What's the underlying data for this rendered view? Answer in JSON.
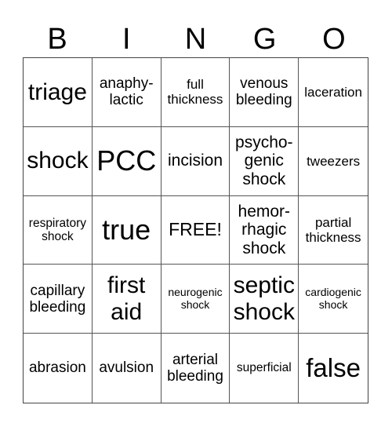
{
  "header": {
    "letters": [
      "B",
      "I",
      "N",
      "G",
      "O"
    ]
  },
  "card": {
    "cells": [
      "triage",
      "anaphy-\nlactic",
      "full\nthickness",
      "venous\nbleeding",
      "laceration",
      "shock",
      "PCC",
      "incision",
      "psycho-\ngenic\nshock",
      "tweezers",
      "respiratory\nshock",
      "true",
      "FREE!",
      "hemor-\nrhagic\nshock",
      "partial\nthickness",
      "capillary\nbleeding",
      "first\naid",
      "neurogenic\nshock",
      "septic\nshock",
      "cardiogenic\nshock",
      "abrasion",
      "avulsion",
      "arterial\nbleeding",
      "superficial",
      "false"
    ]
  }
}
